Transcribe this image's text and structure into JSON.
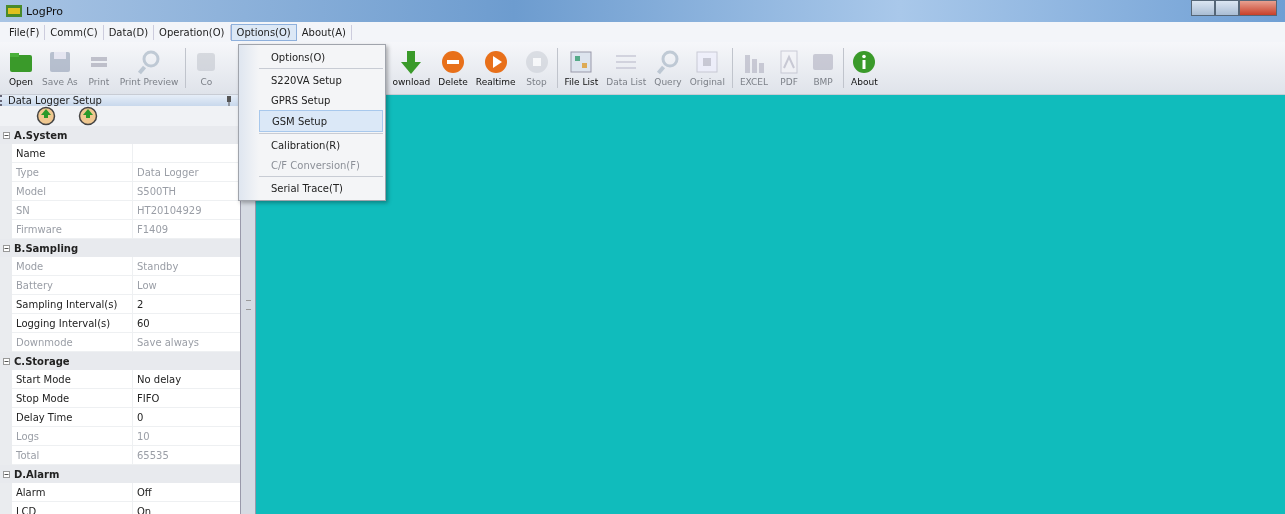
{
  "window": {
    "title": "LogPro"
  },
  "menu": [
    {
      "label": "File(F)",
      "selected": false
    },
    {
      "label": "Comm(C)",
      "selected": false
    },
    {
      "label": "Data(D)",
      "selected": false
    },
    {
      "label": "Operation(O)",
      "selected": false
    },
    {
      "label": "Options(O)",
      "selected": true
    },
    {
      "label": "About(A)",
      "selected": false
    }
  ],
  "toolbar": [
    {
      "kind": "button",
      "label": "Open",
      "disabled": false
    },
    {
      "kind": "button",
      "label": "Save As",
      "disabled": true
    },
    {
      "kind": "button",
      "label": "Print",
      "disabled": true
    },
    {
      "kind": "button",
      "label": "Print Preview",
      "disabled": true
    },
    {
      "kind": "separator"
    },
    {
      "kind": "button",
      "label": "Co",
      "disabled": true
    },
    {
      "kind": "gap"
    },
    {
      "kind": "button",
      "label": "ownload",
      "disabled": false
    },
    {
      "kind": "button",
      "label": "Delete",
      "disabled": false
    },
    {
      "kind": "button",
      "label": "Realtime",
      "disabled": false
    },
    {
      "kind": "button",
      "label": "Stop",
      "disabled": true
    },
    {
      "kind": "separator"
    },
    {
      "kind": "button",
      "label": "File List",
      "disabled": false
    },
    {
      "kind": "button",
      "label": "Data List",
      "disabled": true
    },
    {
      "kind": "button",
      "label": "Query",
      "disabled": true
    },
    {
      "kind": "button",
      "label": "Original",
      "disabled": true
    },
    {
      "kind": "separator"
    },
    {
      "kind": "button",
      "label": "EXCEL",
      "disabled": true
    },
    {
      "kind": "button",
      "label": "PDF",
      "disabled": true
    },
    {
      "kind": "button",
      "label": "BMP",
      "disabled": true
    },
    {
      "kind": "separator"
    },
    {
      "kind": "button",
      "label": "About",
      "disabled": false
    }
  ],
  "options_menu": [
    {
      "kind": "item",
      "label": "Options(O)",
      "selected": false,
      "disabled": false
    },
    {
      "kind": "separator"
    },
    {
      "kind": "item",
      "label": "S220VA Setup",
      "selected": false,
      "disabled": false
    },
    {
      "kind": "item",
      "label": "GPRS Setup",
      "selected": false,
      "disabled": false
    },
    {
      "kind": "item",
      "label": "GSM Setup",
      "selected": true,
      "disabled": false
    },
    {
      "kind": "separator"
    },
    {
      "kind": "item",
      "label": "Calibration(R)",
      "selected": false,
      "disabled": false
    },
    {
      "kind": "item",
      "label": "C/F Conversion(F)",
      "selected": false,
      "disabled": true
    },
    {
      "kind": "separator"
    },
    {
      "kind": "item",
      "label": "Serial Trace(T)",
      "selected": false,
      "disabled": false
    }
  ],
  "panel": {
    "title": "Data Logger Setup",
    "categories": [
      {
        "label": "A.System",
        "expanded": true,
        "rows": [
          {
            "name": "Name",
            "value": "",
            "disabled": false
          },
          {
            "name": "Type",
            "value": "Data Logger",
            "disabled": true
          },
          {
            "name": "Model",
            "value": "S500TH",
            "disabled": true
          },
          {
            "name": "SN",
            "value": "HT20104929",
            "disabled": true
          },
          {
            "name": "Firmware",
            "value": "F1409",
            "disabled": true
          }
        ]
      },
      {
        "label": "B.Sampling",
        "expanded": true,
        "rows": [
          {
            "name": "Mode",
            "value": "Standby",
            "disabled": true
          },
          {
            "name": "Battery",
            "value": "Low",
            "disabled": true
          },
          {
            "name": "Sampling Interval(s)",
            "value": "2",
            "disabled": false
          },
          {
            "name": "Logging Interval(s)",
            "value": "60",
            "disabled": false
          },
          {
            "name": "Downmode",
            "value": "Save always",
            "disabled": true
          }
        ]
      },
      {
        "label": "C.Storage",
        "expanded": true,
        "rows": [
          {
            "name": "Start Mode",
            "value": "No delay",
            "disabled": false
          },
          {
            "name": "Stop Mode",
            "value": "FIFO",
            "disabled": false
          },
          {
            "name": "Delay Time",
            "value": "0",
            "disabled": false
          },
          {
            "name": "Logs",
            "value": "10",
            "disabled": true
          },
          {
            "name": "Total",
            "value": "65535",
            "disabled": true
          }
        ]
      },
      {
        "label": "D.Alarm",
        "expanded": true,
        "rows": [
          {
            "name": "Alarm",
            "value": "Off",
            "disabled": false
          },
          {
            "name": "LCD",
            "value": "On",
            "disabled": false
          }
        ]
      }
    ]
  }
}
